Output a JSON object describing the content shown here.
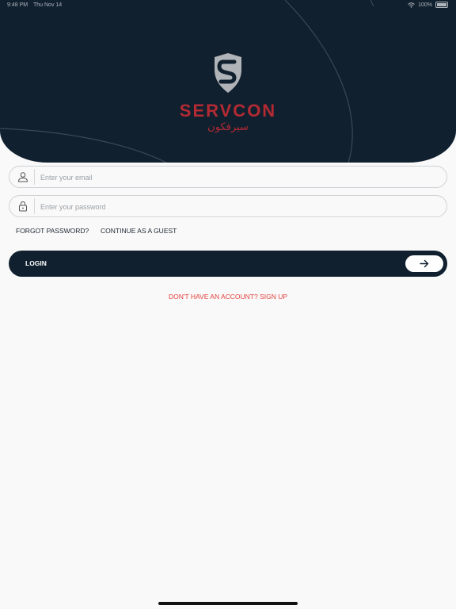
{
  "status_bar": {
    "time": "9:48 PM",
    "date": "Thu Nov 14",
    "battery": "100%"
  },
  "brand": {
    "name": "SERVCON",
    "name_arabic": "سيرفكون"
  },
  "form": {
    "email_placeholder": "Enter your email",
    "password_placeholder": "Enter your password",
    "forgot_password": "FORGOT PASSWORD?",
    "continue_guest": "CONTINUE AS A GUEST",
    "login_label": "LOGIN",
    "signup_link": "DON'T HAVE AN ACCOUNT? SIGN UP"
  },
  "colors": {
    "header_bg": "#11202f",
    "brand_red": "#b32a33",
    "signup_red": "#e4423e",
    "background": "#f9f9f9"
  },
  "icons": {
    "email": "user-icon",
    "password": "lock-icon",
    "login": "arrow-right-icon",
    "logo": "shield-s-icon"
  }
}
